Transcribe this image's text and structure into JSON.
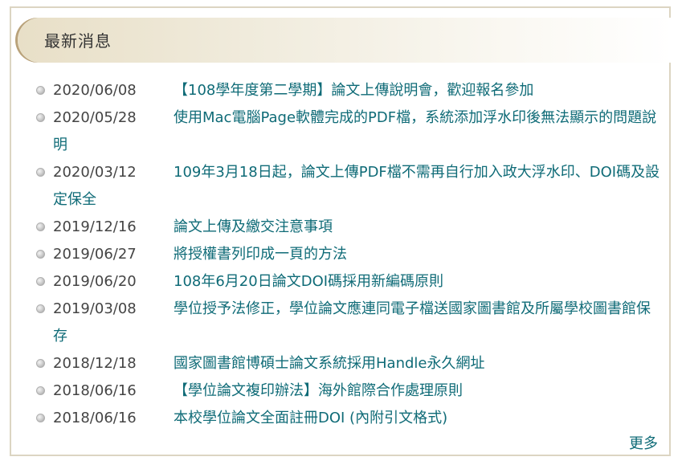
{
  "header": {
    "title": "最新消息"
  },
  "news": [
    {
      "date": "2020/06/08",
      "title": "【108學年度第二學期】論文上傳說明會，歡迎報名參加"
    },
    {
      "date": "2020/05/28",
      "title": "使用Mac電腦Page軟體完成的PDF檔，系統添加浮水印後無法顯示的問題說明"
    },
    {
      "date": "2020/03/12",
      "title": "109年3月18日起，論文上傳PDF檔不需再自行加入政大浮水印、DOI碼及設定保全"
    },
    {
      "date": "2019/12/16",
      "title": "論文上傳及繳交注意事項"
    },
    {
      "date": "2019/06/27",
      "title": "將授權書列印成一頁的方法"
    },
    {
      "date": "2019/06/20",
      "title": "108年6月20日論文DOI碼採用新編碼原則"
    },
    {
      "date": "2019/03/08",
      "title": "學位授予法修正，學位論文應連同電子檔送國家圖書館及所屬學校圖書館保存"
    },
    {
      "date": "2018/12/18",
      "title": "國家圖書館博碩士論文系統採用Handle永久網址"
    },
    {
      "date": "2018/06/16",
      "title": "【學位論文複印辦法】海外館際合作處理原則"
    },
    {
      "date": "2018/06/16",
      "title": "本校學位論文全面註冊DOI (內附引文格式)"
    }
  ],
  "footer": {
    "more_label": "更多"
  },
  "colors": {
    "link": "#0f6b77",
    "date": "#444444",
    "header_bg": "#ece4ce",
    "border": "#dcd5c2"
  }
}
